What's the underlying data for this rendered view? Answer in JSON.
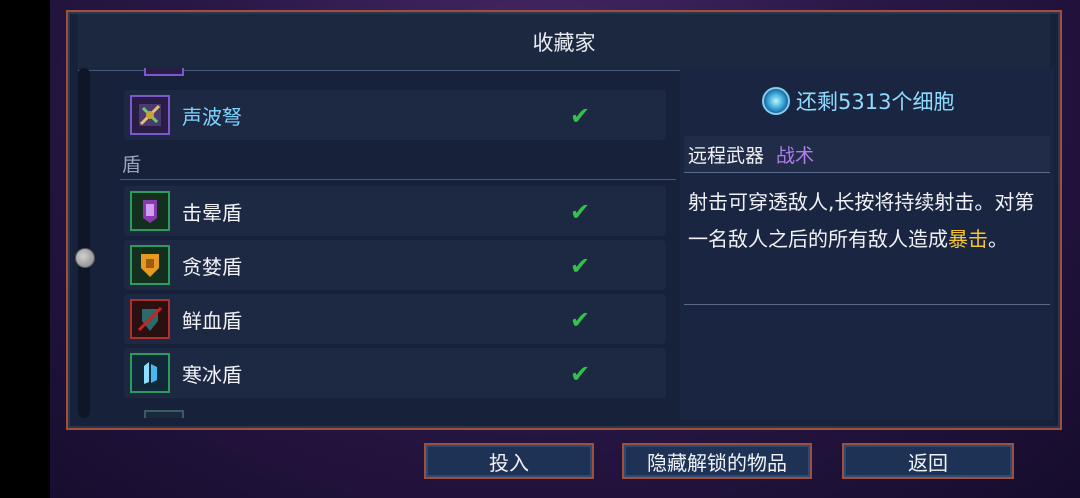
{
  "panel": {
    "title": "收藏家"
  },
  "list": {
    "category_shield": "盾",
    "items": [
      {
        "name": "声波弩",
        "icon": "sonic-crossbow-icon",
        "selected": true,
        "unlocked": true
      },
      {
        "name": "击晕盾",
        "icon": "stun-shield-icon",
        "selected": false,
        "unlocked": true
      },
      {
        "name": "贪婪盾",
        "icon": "greed-shield-icon",
        "selected": false,
        "unlocked": true
      },
      {
        "name": "鲜血盾",
        "icon": "blood-shield-icon",
        "selected": false,
        "unlocked": true
      },
      {
        "name": "寒冰盾",
        "icon": "ice-shield-icon",
        "selected": false,
        "unlocked": true
      }
    ],
    "check_glyph": "✔"
  },
  "details": {
    "cells_text": "还剩5313个细胞",
    "type_label": "远程武器",
    "tag_label": "战术",
    "desc_part1": "射击可穿透敌人,长按将持续射击。对第一名敌人之后的所有敌人造成",
    "desc_crit": "暴击",
    "desc_end": "。"
  },
  "buttons": {
    "invest": "投入",
    "hide_unlocked": "隐藏解锁的物品",
    "back": "返回"
  },
  "colors": {
    "accent_border": "#a0503a",
    "check": "#31c24a",
    "tag_purple": "#b27cf0",
    "crit_yellow": "#f4c430",
    "cells_blue": "#8fdcff"
  }
}
